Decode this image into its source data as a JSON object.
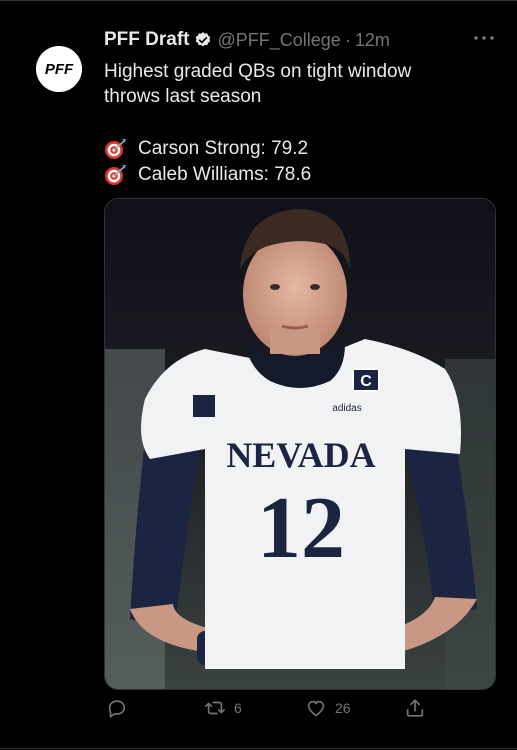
{
  "tweet": {
    "author_name": "PFF Draft",
    "handle": "@PFF_College",
    "separator": "·",
    "time": "12m",
    "avatar_text": "PFF",
    "text_line1": "Highest graded QBs on tight window",
    "text_line2": "throws last season",
    "stats": [
      {
        "label": "Carson Strong: 79.2"
      },
      {
        "label": "Caleb Williams: 78.6"
      }
    ],
    "media": {
      "jersey_team": "NEVADA",
      "jersey_number": "12",
      "captain_patch": "C",
      "brand": "adidas"
    },
    "actions": {
      "reply_count": "",
      "retweet_count": "6",
      "like_count": "26"
    }
  },
  "icons": {
    "verified": "verified-badge-icon",
    "more": "more-dots-icon",
    "target": "direct-hit-icon",
    "reply": "reply-icon",
    "retweet": "retweet-icon",
    "like": "heart-icon",
    "share": "share-icon"
  },
  "colors": {
    "background": "#000000",
    "text": "#e7e9ea",
    "secondary": "#71767b",
    "border": "#2f3336",
    "jersey_navy": "#1b2440"
  }
}
